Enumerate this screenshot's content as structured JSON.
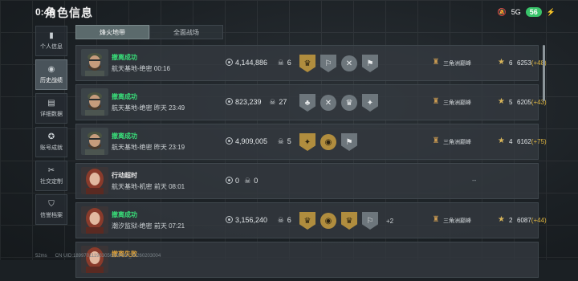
{
  "header": {
    "time": "0:46",
    "title": "角色信息"
  },
  "statusbar": {
    "network": "5G",
    "battery": "56"
  },
  "sidebar": {
    "items": [
      {
        "label": "个人信息",
        "icon": "bar-chart-icon",
        "active": false
      },
      {
        "label": "历史战绩",
        "icon": "eye-icon",
        "active": true
      },
      {
        "label": "详细数据",
        "icon": "chat-icon",
        "active": false
      },
      {
        "label": "账号成就",
        "icon": "medal-icon",
        "active": false
      },
      {
        "label": "社交定制",
        "icon": "tools-icon",
        "active": false
      },
      {
        "label": "信誉档案",
        "icon": "shield-icon",
        "active": false
      }
    ]
  },
  "tabs": [
    {
      "label": "烽火地带",
      "active": true
    },
    {
      "label": "全面战场",
      "active": false
    }
  ],
  "rows": [
    {
      "avatar": "male",
      "status": "撤离成功",
      "status_type": "ok",
      "map_time": "航天基地-绝密 00:16",
      "money": "4,144,886",
      "kills": "6",
      "badges": [
        {
          "g": "♛",
          "c": "gold"
        },
        {
          "g": "⚐",
          "c": "gray"
        },
        {
          "g": "✕",
          "c": "gray round"
        },
        {
          "g": "⚑",
          "c": "gray"
        }
      ],
      "extra": "",
      "rank_name": "三角洲巅峰",
      "rank_level": "6",
      "rank_score": "6253",
      "rank_delta": "(+48)"
    },
    {
      "avatar": "male",
      "status": "撤离成功",
      "status_type": "ok",
      "map_time": "航天基地-绝密 昨天 23:49",
      "money": "823,239",
      "kills": "27",
      "badges": [
        {
          "g": "♣",
          "c": "gray"
        },
        {
          "g": "✕",
          "c": "gray round"
        },
        {
          "g": "♛",
          "c": "gray round"
        },
        {
          "g": "✦",
          "c": "gray"
        }
      ],
      "extra": "",
      "rank_name": "三角洲巅峰",
      "rank_level": "5",
      "rank_score": "6205",
      "rank_delta": "(+43)"
    },
    {
      "avatar": "male",
      "status": "撤离成功",
      "status_type": "ok",
      "map_time": "航天基地-绝密 昨天 23:19",
      "money": "4,909,005",
      "kills": "5",
      "badges": [
        {
          "g": "✦",
          "c": "gold"
        },
        {
          "g": "◉",
          "c": "gold round"
        },
        {
          "g": "⚑",
          "c": "gray"
        }
      ],
      "extra": "",
      "rank_name": "三角洲巅峰",
      "rank_level": "4",
      "rank_score": "6162",
      "rank_delta": "(+75)"
    },
    {
      "avatar": "female",
      "status": "行动超时",
      "status_type": "timeout",
      "map_time": "航天基地-机密 前天 08:01",
      "money": "0",
      "kills": "0",
      "badges": [],
      "extra": "",
      "dash": "--",
      "rank_name": "",
      "rank_level": "",
      "rank_score": "",
      "rank_delta": ""
    },
    {
      "avatar": "female",
      "status": "撤离成功",
      "status_type": "ok",
      "map_time": "潮汐监狱-绝密 前天 07:21",
      "money": "3,156,240",
      "kills": "6",
      "badges": [
        {
          "g": "♛",
          "c": "gold"
        },
        {
          "g": "◉",
          "c": "gold round"
        },
        {
          "g": "♛",
          "c": "gold"
        },
        {
          "g": "⚐",
          "c": "gray"
        }
      ],
      "extra": "+2",
      "rank_name": "三角洲巅峰",
      "rank_level": "2",
      "rank_score": "6087",
      "rank_delta": "(+44)"
    }
  ],
  "partial_row": {
    "status": "撤离失败"
  },
  "footer": {
    "ping": "52ms",
    "uid": "CN UID:189970111933056245542_20260203004"
  },
  "colors": {
    "success": "#39e07a",
    "gold": "#e0b640",
    "active_tab": "#5b6a6c"
  }
}
